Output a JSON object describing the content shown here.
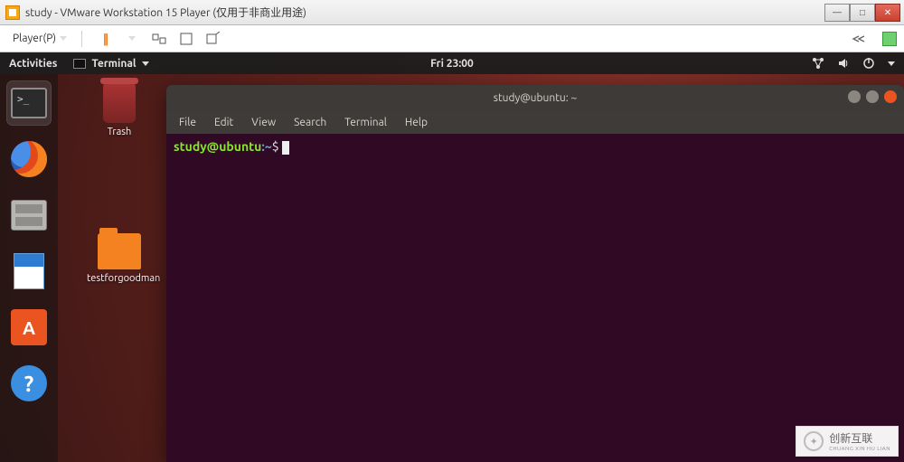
{
  "window": {
    "title": "study - VMware Workstation 15 Player (仅用于非商业用途)"
  },
  "vmware_toolbar": {
    "player_label": "Player(P)"
  },
  "ubuntu_bar": {
    "activities": "Activities",
    "app_indicator": "Terminal",
    "clock": "Fri 23:00"
  },
  "desktop": {
    "trash_label": "Trash",
    "folder1_label": "testforgoodman"
  },
  "terminal": {
    "title": "study@ubuntu: ~",
    "menu": [
      "File",
      "Edit",
      "View",
      "Search",
      "Terminal",
      "Help"
    ],
    "prompt_user_host": "study@ubuntu",
    "prompt_colon": ":",
    "prompt_path": "~",
    "prompt_symbol": "$"
  },
  "watermark": {
    "text": "创新互联",
    "sub": "CHUANG XIN HU LIAN"
  }
}
